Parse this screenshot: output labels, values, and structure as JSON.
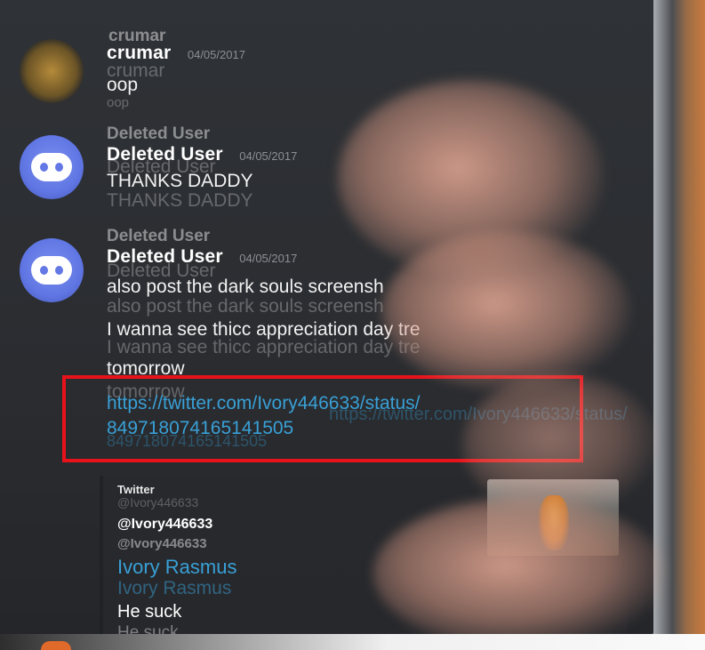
{
  "messages": [
    {
      "author": "crumar",
      "timestamp": "04/05/2017",
      "lines": [
        "oop"
      ]
    },
    {
      "author": "Deleted User",
      "timestamp": "04/05/2017",
      "lines": [
        "THANKS DADDY"
      ]
    },
    {
      "author": "Deleted User",
      "timestamp": "04/05/2017",
      "lines": [
        "also post the dark souls screensh",
        "I wanna see thicc appreciation day tre",
        "tomorrow"
      ],
      "link_lines": [
        "https://twitter.com/Ivory446633/status/",
        "849718074165141505"
      ]
    }
  ],
  "embed": {
    "provider": "Twitter",
    "handle": "@Ivory446633",
    "author_name": "Ivory Rasmus",
    "text": "He suck"
  },
  "colors": {
    "link": "#39a0d6",
    "highlight": "#e8121b",
    "background": "#2f3236"
  }
}
